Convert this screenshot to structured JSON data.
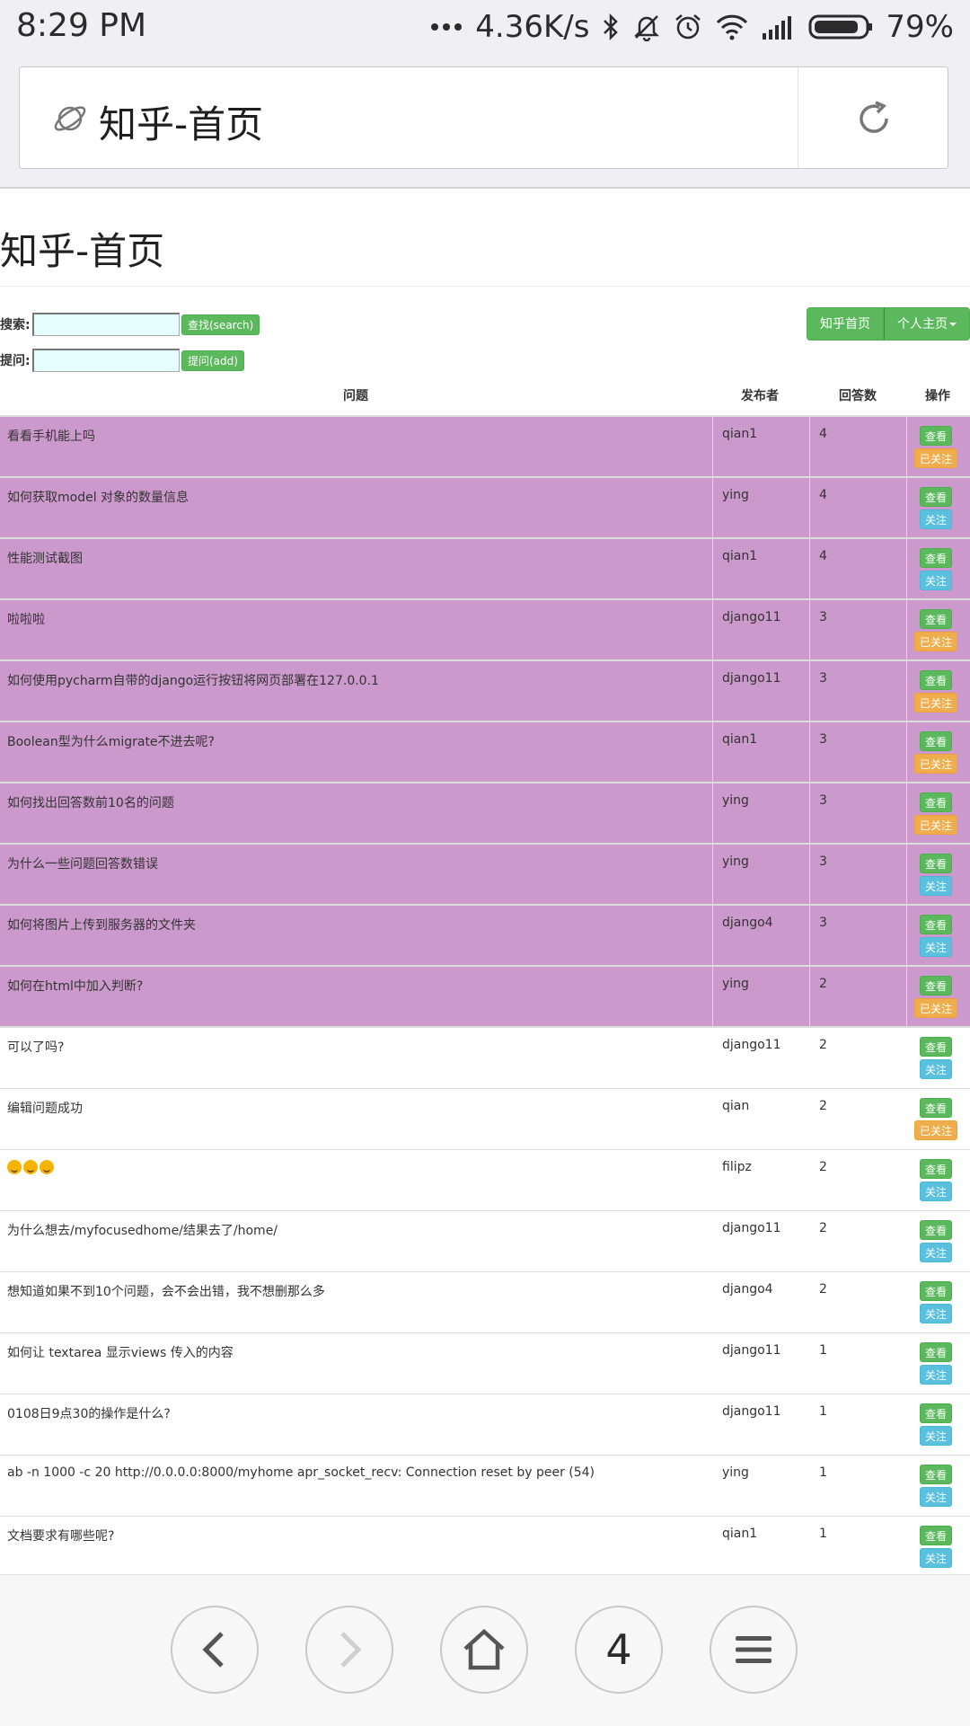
{
  "status_bar": {
    "time": "8:29 PM",
    "net_speed": "4.36K/s",
    "battery": "79%"
  },
  "browser": {
    "address_title": "知乎-首页",
    "tab_count": "4"
  },
  "page": {
    "header": "知乎-首页",
    "search_label": "搜索:",
    "search_button": "查找(search)",
    "ask_label": "提问:",
    "ask_button": "提问(add)",
    "nav_home": "知乎首页",
    "nav_personal": "个人主页"
  },
  "table": {
    "col_question": "问题",
    "col_author": "发布者",
    "col_answers": "回答数",
    "col_ops": "操作",
    "view_label": "查看",
    "follow_label": "关注",
    "followed_label": "已关注",
    "rows": [
      {
        "q": "看看手机能上吗",
        "author": "qian1",
        "n": "4",
        "followed": true,
        "hl": true
      },
      {
        "q": "如何获取model 对象的数量信息",
        "author": "ying",
        "n": "4",
        "followed": false,
        "hl": true
      },
      {
        "q": "性能测试截图",
        "author": "qian1",
        "n": "4",
        "followed": false,
        "hl": true
      },
      {
        "q": "啦啦啦",
        "author": "django11",
        "n": "3",
        "followed": true,
        "hl": true
      },
      {
        "q": "如何使用pycharm自带的django运行按钮将网页部署在127.0.0.1",
        "author": "django11",
        "n": "3",
        "followed": true,
        "hl": true
      },
      {
        "q": "Boolean型为什么migrate不进去呢?",
        "author": "qian1",
        "n": "3",
        "followed": true,
        "hl": true
      },
      {
        "q": "如何找出回答数前10名的问题",
        "author": "ying",
        "n": "3",
        "followed": true,
        "hl": true
      },
      {
        "q": "为什么一些问题回答数错误",
        "author": "ying",
        "n": "3",
        "followed": false,
        "hl": true
      },
      {
        "q": "如何将图片上传到服务器的文件夹",
        "author": "django4",
        "n": "3",
        "followed": false,
        "hl": true
      },
      {
        "q": "如何在html中加入判断?",
        "author": "ying",
        "n": "2",
        "followed": true,
        "hl": true
      },
      {
        "q": "可以了吗?",
        "author": "django11",
        "n": "2",
        "followed": false,
        "hl": false
      },
      {
        "q": "编辑问题成功",
        "author": "qian",
        "n": "2",
        "followed": true,
        "hl": false
      },
      {
        "q": "",
        "emoji": 3,
        "author": "filipz",
        "n": "2",
        "followed": false,
        "hl": false
      },
      {
        "q": "为什么想去/myfocusedhome/结果去了/home/",
        "author": "django11",
        "n": "2",
        "followed": false,
        "hl": false
      },
      {
        "q": "想知道如果不到10个问题，会不会出错，我不想删那么多",
        "author": "django4",
        "n": "2",
        "followed": false,
        "hl": false
      },
      {
        "q": "如何让 textarea 显示views 传入的内容",
        "author": "django11",
        "n": "1",
        "followed": false,
        "hl": false
      },
      {
        "q": "0108日9点30的操作是什么?",
        "author": "django11",
        "n": "1",
        "followed": false,
        "hl": false
      },
      {
        "q": "ab -n 1000 -c 20 http://0.0.0.0:8000/myhome apr_socket_recv: Connection reset by peer (54)",
        "author": "ying",
        "n": "1",
        "followed": false,
        "hl": false
      },
      {
        "q": "文档要求有哪些呢?",
        "author": "qian1",
        "n": "1",
        "followed": false,
        "hl": false
      }
    ]
  },
  "colors": {
    "highlight_row": "#cc99cc",
    "btn_success": "#5cb85c",
    "btn_info": "#5bc0de",
    "btn_warning": "#f0ad4e"
  },
  "icons": {
    "address": "planet-icon",
    "reload": "reload-icon",
    "back": "back-arrow-icon",
    "forward": "forward-arrow-icon",
    "home": "home-icon",
    "menu": "menu-icon"
  }
}
